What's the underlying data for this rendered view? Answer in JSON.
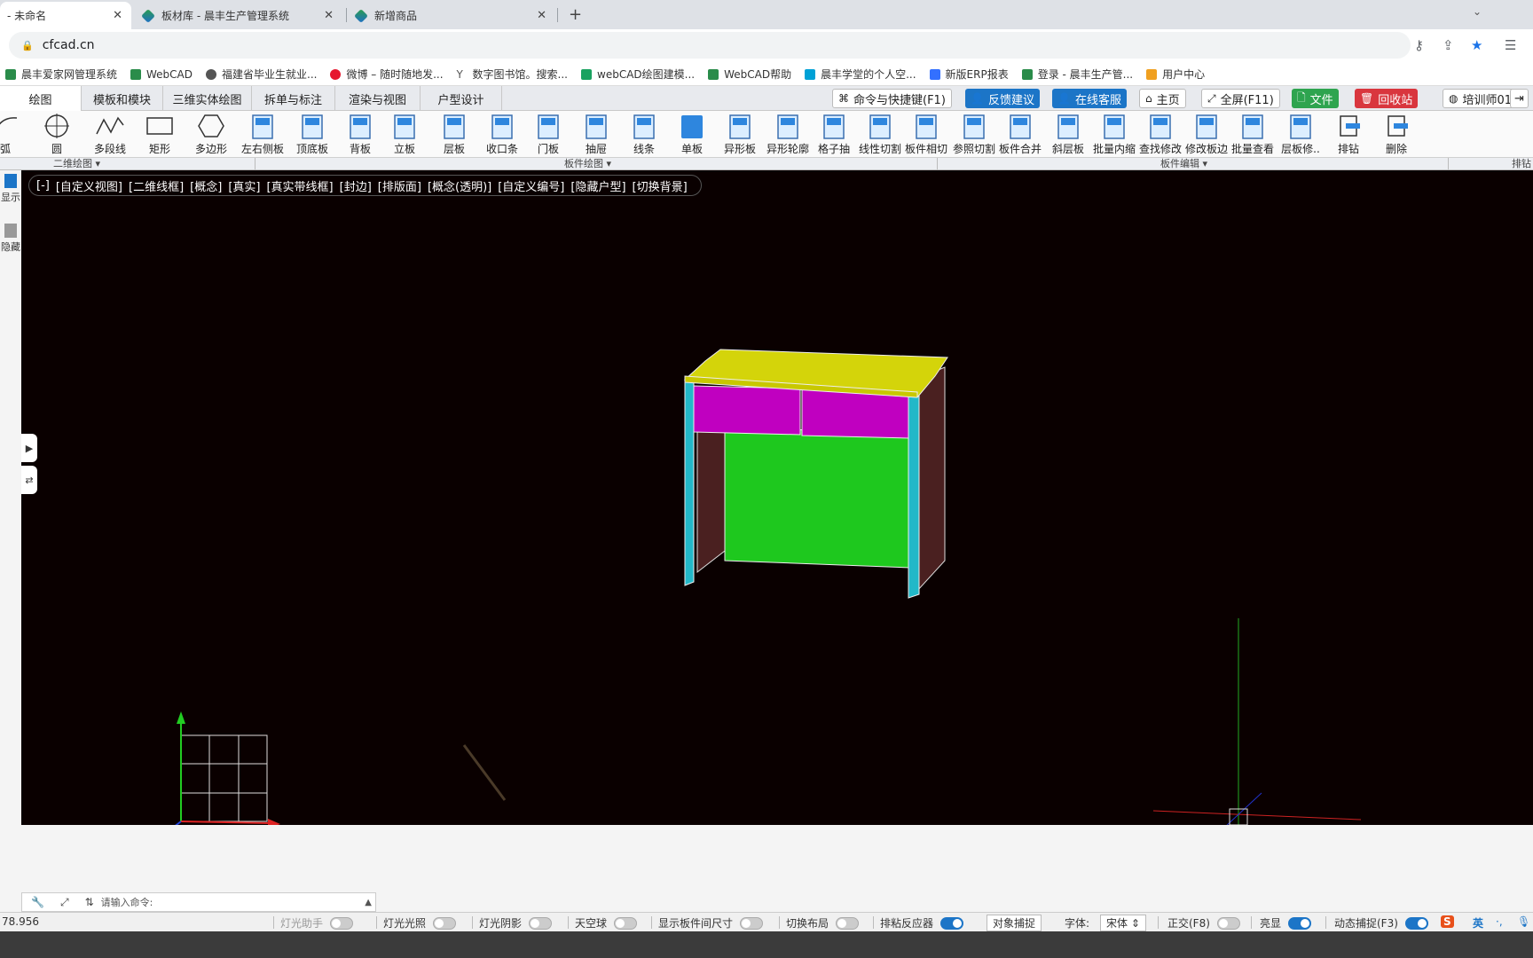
{
  "browser": {
    "tabs": [
      {
        "label": "- 未命名",
        "active": true
      },
      {
        "label": "板材库 - 晨丰生产管理系统",
        "active": false
      },
      {
        "label": "新增商品",
        "active": false
      }
    ],
    "new_tab": "+",
    "url": "cfcad.cn",
    "bookmarks": [
      "晨丰爱家网管理系统",
      "WebCAD",
      "福建省毕业生就业...",
      "微博 – 随时随地发...",
      "数字图书馆。搜索...",
      "webCAD绘图建模...",
      "WebCAD帮助",
      "晨丰学堂的个人空...",
      "新版ERP报表",
      "登录 - 晨丰生产管...",
      "用户中心"
    ]
  },
  "menu": {
    "tabs": [
      "绘图",
      "模板和模块",
      "三维实体绘图",
      "拆单与标注",
      "渲染与视图",
      "户型设计"
    ],
    "buttons": {
      "command": "命令与快捷键(F1)",
      "feedback": "反馈建议",
      "service": "在线客服",
      "home": "主页",
      "fullscreen": "全屏(F11)",
      "file": "文件",
      "recycle": "回收站",
      "user": "培训师01"
    }
  },
  "tools": [
    {
      "label": "弧",
      "icon": "arc-icon"
    },
    {
      "label": "圆",
      "icon": "circle-icon"
    },
    {
      "label": "多段线",
      "icon": "polyline-icon"
    },
    {
      "label": "矩形",
      "icon": "rectangle-icon"
    },
    {
      "label": "多边形",
      "icon": "polygon-icon"
    },
    {
      "label": "左右侧板",
      "icon": "side-panel-icon"
    },
    {
      "label": "顶底板",
      "icon": "top-bottom-panel-icon"
    },
    {
      "label": "背板",
      "icon": "back-panel-icon"
    },
    {
      "label": "立板",
      "icon": "vertical-panel-icon"
    },
    {
      "label": "层板",
      "icon": "shelf-icon"
    },
    {
      "label": "收口条",
      "icon": "edge-strip-icon"
    },
    {
      "label": "门板",
      "icon": "door-panel-icon"
    },
    {
      "label": "抽屉",
      "icon": "drawer-icon"
    },
    {
      "label": "线条",
      "icon": "line-icon"
    },
    {
      "label": "单板",
      "icon": "single-board-icon"
    },
    {
      "label": "异形板",
      "icon": "shaped-board-icon"
    },
    {
      "label": "异形轮廓",
      "icon": "shaped-profile-icon"
    },
    {
      "label": "格子抽",
      "icon": "grid-drawer-icon"
    },
    {
      "label": "线性切割",
      "icon": "linear-cut-icon"
    },
    {
      "label": "板件相切",
      "icon": "board-tangent-icon"
    },
    {
      "label": "参照切割",
      "icon": "reference-cut-icon"
    },
    {
      "label": "板件合并",
      "icon": "board-merge-icon"
    },
    {
      "label": "斜层板",
      "icon": "slanted-shelf-icon"
    },
    {
      "label": "批量内缩",
      "icon": "batch-shrink-icon"
    },
    {
      "label": "查找修改",
      "icon": "find-modify-icon"
    },
    {
      "label": "修改板边",
      "icon": "modify-edge-icon"
    },
    {
      "label": "批量查看",
      "icon": "batch-view-icon"
    },
    {
      "label": "层板修..",
      "icon": "shelf-modify-icon"
    },
    {
      "label": "排钻",
      "icon": "drill-icon"
    },
    {
      "label": "删除",
      "icon": "delete-icon"
    }
  ],
  "groups": {
    "g1": "二维绘图",
    "g2": "板件绘图",
    "g3": "板件编辑",
    "g4": "排钻"
  },
  "left_panel": {
    "item1": "显示",
    "item2": "隐藏"
  },
  "viewbar": [
    "[-]",
    "[自定义视图]",
    "[二维线框]",
    "[概念]",
    "[真实]",
    "[真实带线框]",
    "[封边]",
    "[排版面]",
    "[概念(透明)]",
    "[自定义编号]",
    "[隐藏户型]",
    "[切换背景]"
  ],
  "colors": {
    "viewport_bg": "#0a0000",
    "top_panel": "#d4d40a",
    "drawer_front": "#c000c0",
    "back_panel": "#1ec81e",
    "side_panel": "#4a2020",
    "edge": "#22b8c8",
    "accent_blue": "#1c75c7"
  },
  "command": {
    "placeholder": "请输入命令:"
  },
  "status": {
    "coord": "78.956",
    "items": [
      {
        "label": "灯光助手",
        "on": false,
        "disabled": true
      },
      {
        "label": "灯光光照",
        "on": false
      },
      {
        "label": "灯光阴影",
        "on": false
      },
      {
        "label": "天空球",
        "on": false
      },
      {
        "label": "显示板件间尺寸",
        "on": false
      },
      {
        "label": "切换布局",
        "on": false
      },
      {
        "label": "排粘反应器",
        "on": true
      }
    ],
    "snap": "对象捕捉",
    "font_label": "字体:",
    "font_value": "宋体",
    "ortho": "正交(F8)",
    "highlight": "亮显",
    "dynamic": "动态捕捉(F3)",
    "ime": "英"
  }
}
